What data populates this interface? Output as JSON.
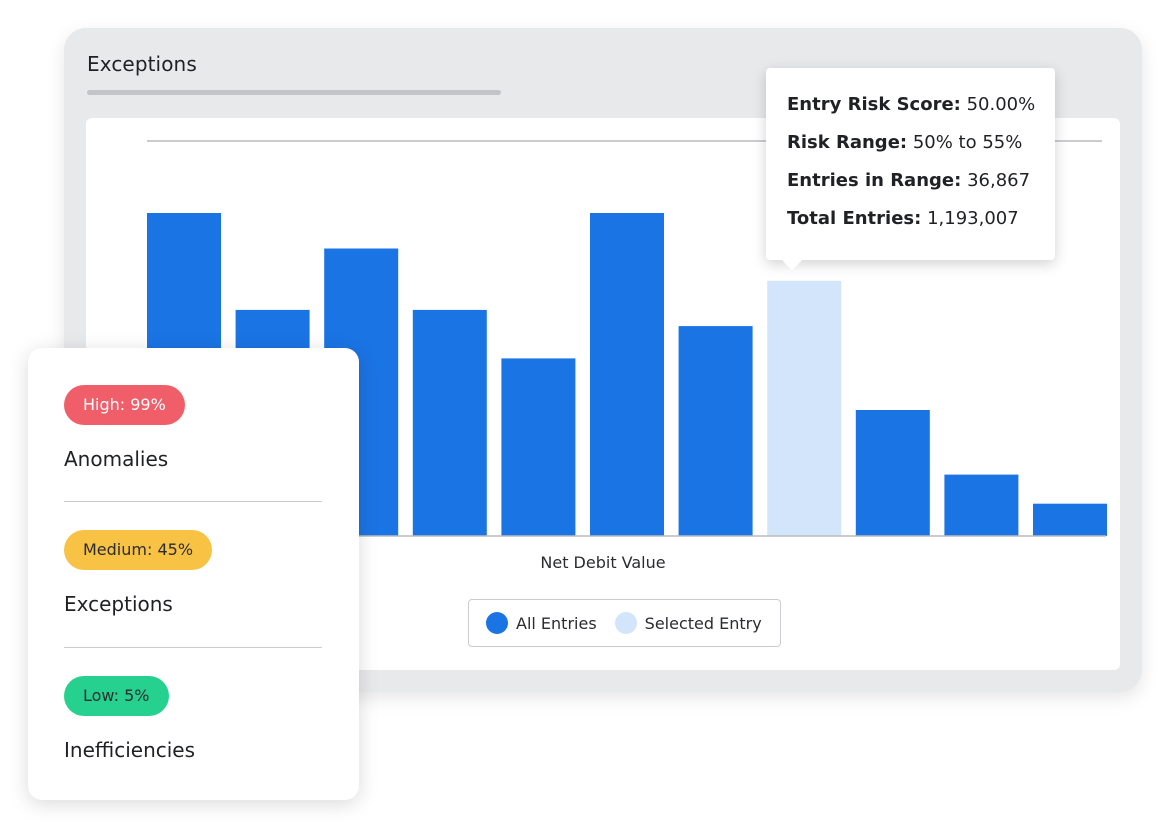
{
  "window": {
    "title": "Exceptions"
  },
  "tooltip": {
    "rows": [
      {
        "key": "Entry Risk Score:",
        "value": "50.00%"
      },
      {
        "key": "Risk Range:",
        "value": "50% to 55%"
      },
      {
        "key": "Entries in Range:",
        "value": "36,867"
      },
      {
        "key": "Total Entries:",
        "value": "1,193,007"
      }
    ]
  },
  "legend": {
    "all_entries": "All Entries",
    "selected_entry": "Selected Entry"
  },
  "risk_panel": {
    "items": [
      {
        "badge": "High: 99%",
        "label": "Anomalies",
        "color": "#f05e6a",
        "text_color": "#ffffff"
      },
      {
        "badge": "Medium: 45%",
        "label": "Exceptions",
        "color": "#f8c245",
        "text_color": "#2a2c30"
      },
      {
        "badge": "Low: 5%",
        "label": "Inefficiencies",
        "color": "#26d08f",
        "text_color": "#2a2c30"
      }
    ]
  },
  "colors": {
    "bar": "#1b74e4",
    "selected": "#d3e5fb"
  },
  "chart_data": {
    "type": "bar",
    "xlabel": "Net Debit Value",
    "ylabel": "",
    "values": [
      100,
      70,
      89,
      70,
      55,
      100,
      65,
      79,
      39,
      19,
      10
    ],
    "ylim": [
      0,
      120
    ],
    "selected_index": 7,
    "series": [
      {
        "name": "All Entries"
      },
      {
        "name": "Selected Entry"
      }
    ],
    "legend_position": "bottom-center",
    "grid": false
  }
}
